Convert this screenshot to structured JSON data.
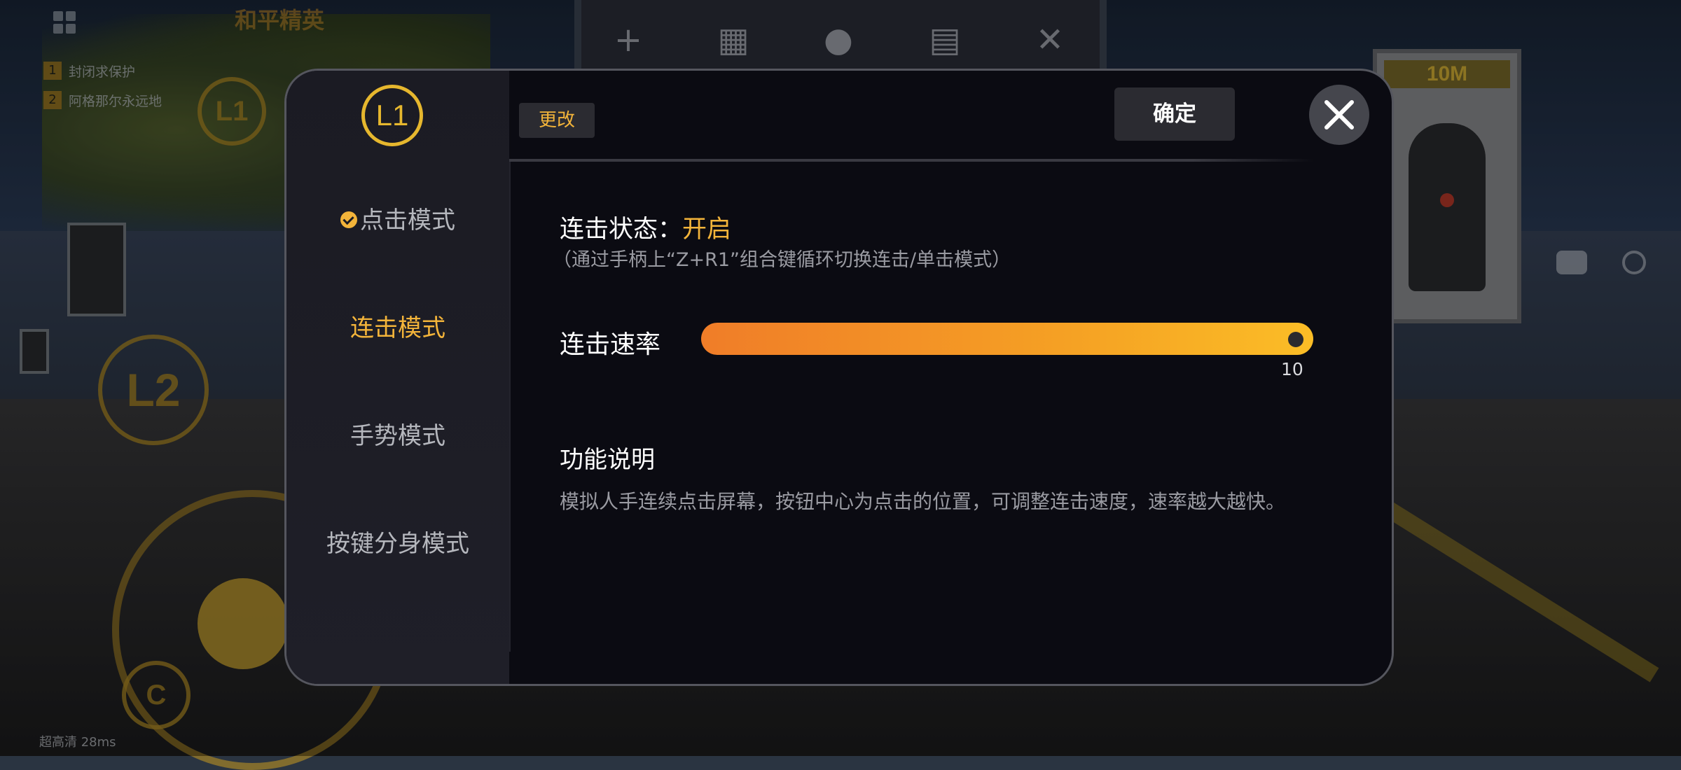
{
  "background": {
    "logo": "和平精英",
    "notices": [
      {
        "rank": "1",
        "text": "封闭求保护"
      },
      {
        "rank": "2",
        "text": "阿格那尔永远地"
      }
    ],
    "buttons": {
      "l1": "L1",
      "l2": "L2",
      "c": "C"
    },
    "target_banner": "10M",
    "status": "超高清  28ms"
  },
  "modal": {
    "badge": "L1",
    "modes": [
      {
        "label": "点击模式",
        "checked": true
      },
      {
        "label": "连击模式",
        "active": true
      },
      {
        "label": "手势模式"
      },
      {
        "label": "按键分身模式"
      }
    ],
    "edit_label": "更改",
    "confirm_label": "确定",
    "state_label": "连击状态：",
    "state_value": "开启",
    "state_hint": "（通过手柄上“Z+R1”组合键循环切换连击/单击模式）",
    "rate_label": "连击速率",
    "rate_value": "10",
    "rate_fraction": 1.0,
    "desc_title": "功能说明",
    "desc_text": "模拟人手连续点击屏幕，按钮中心为点击的位置，可调整连击速度，速率越大越快。"
  },
  "colors": {
    "accent": "#f3b43a",
    "slider_start": "#f07d28",
    "slider_end": "#fbbd26"
  }
}
